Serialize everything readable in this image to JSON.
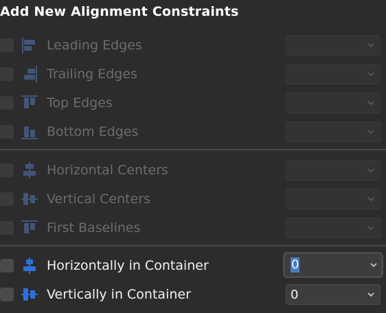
{
  "title": "Add New Alignment Constraints",
  "colors": {
    "background": "#2c2c2c",
    "accent": "#2f6fde",
    "focus_ring": "#2e5f8f",
    "text_disabled": "#6c6c6c",
    "text_enabled": "#f2f2f2"
  },
  "rows": [
    {
      "label": "Leading Edges",
      "icon": "align-leading-edges-icon",
      "enabled": false,
      "value": ""
    },
    {
      "label": "Trailing Edges",
      "icon": "align-trailing-edges-icon",
      "enabled": false,
      "value": ""
    },
    {
      "label": "Top Edges",
      "icon": "align-top-edges-icon",
      "enabled": false,
      "value": ""
    },
    {
      "label": "Bottom Edges",
      "icon": "align-bottom-edges-icon",
      "enabled": false,
      "value": ""
    },
    {
      "label": "Horizontal Centers",
      "icon": "align-horizontal-centers-icon",
      "enabled": false,
      "value": ""
    },
    {
      "label": "Vertical Centers",
      "icon": "align-vertical-centers-icon",
      "enabled": false,
      "value": ""
    },
    {
      "label": "First Baselines",
      "icon": "align-first-baselines-icon",
      "enabled": false,
      "value": ""
    },
    {
      "label": "Horizontally in Container",
      "icon": "horizontally-in-container-icon",
      "enabled": true,
      "value": "0",
      "focused": true
    },
    {
      "label": "Vertically in Container",
      "icon": "vertically-in-container-icon",
      "enabled": true,
      "value": "0"
    }
  ]
}
